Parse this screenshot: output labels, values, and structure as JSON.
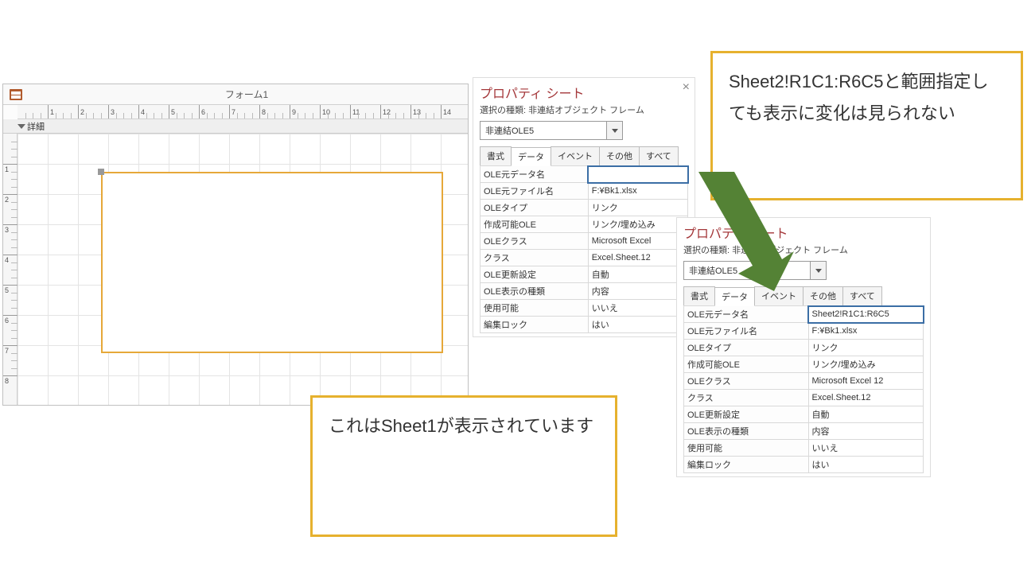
{
  "form": {
    "title": "フォーム1",
    "section_label": "詳細",
    "ruler_h": [
      "1",
      "2",
      "3",
      "4",
      "5",
      "6",
      "7",
      "8",
      "9",
      "10",
      "11",
      "12",
      "13",
      "14"
    ],
    "ruler_v": [
      "1",
      "2",
      "3",
      "4",
      "5",
      "6",
      "7",
      "8"
    ]
  },
  "propsheet_shared": {
    "title": "プロパティ シート",
    "subtitle": "選択の種類: 非連結オブジェクト フレーム",
    "object_name": "非連結OLE5",
    "tabs": {
      "format": "書式",
      "data": "データ",
      "event": "イベント",
      "other": "その他",
      "all": "すべて"
    }
  },
  "props_left": {
    "rows": [
      {
        "name": "OLE元データ名",
        "value": ""
      },
      {
        "name": "OLE元ファイル名",
        "value": "F:¥Bk1.xlsx"
      },
      {
        "name": "OLEタイプ",
        "value": "リンク"
      },
      {
        "name": "作成可能OLE",
        "value": "リンク/埋め込み"
      },
      {
        "name": "OLEクラス",
        "value": "Microsoft Excel"
      },
      {
        "name": "クラス",
        "value": "Excel.Sheet.12"
      },
      {
        "name": "OLE更新設定",
        "value": "自動"
      },
      {
        "name": "OLE表示の種類",
        "value": "内容"
      },
      {
        "name": "使用可能",
        "value": "いいえ"
      },
      {
        "name": "編集ロック",
        "value": "はい"
      }
    ]
  },
  "props_right": {
    "rows": [
      {
        "name": "OLE元データ名",
        "value": "Sheet2!R1C1:R6C5"
      },
      {
        "name": "OLE元ファイル名",
        "value": "F:¥Bk1.xlsx"
      },
      {
        "name": "OLEタイプ",
        "value": "リンク"
      },
      {
        "name": "作成可能OLE",
        "value": "リンク/埋め込み"
      },
      {
        "name": "OLEクラス",
        "value": "Microsoft Excel 12"
      },
      {
        "name": "クラス",
        "value": "Excel.Sheet.12"
      },
      {
        "name": "OLE更新設定",
        "value": "自動"
      },
      {
        "name": "OLE表示の種類",
        "value": "内容"
      },
      {
        "name": "使用可能",
        "value": "いいえ"
      },
      {
        "name": "編集ロック",
        "value": "はい"
      }
    ]
  },
  "callouts": {
    "c1": "これはSheet1が表示されています",
    "c2": "Sheet2!R1C1:R6C5と範囲指定しても表示に変化は見られない"
  }
}
